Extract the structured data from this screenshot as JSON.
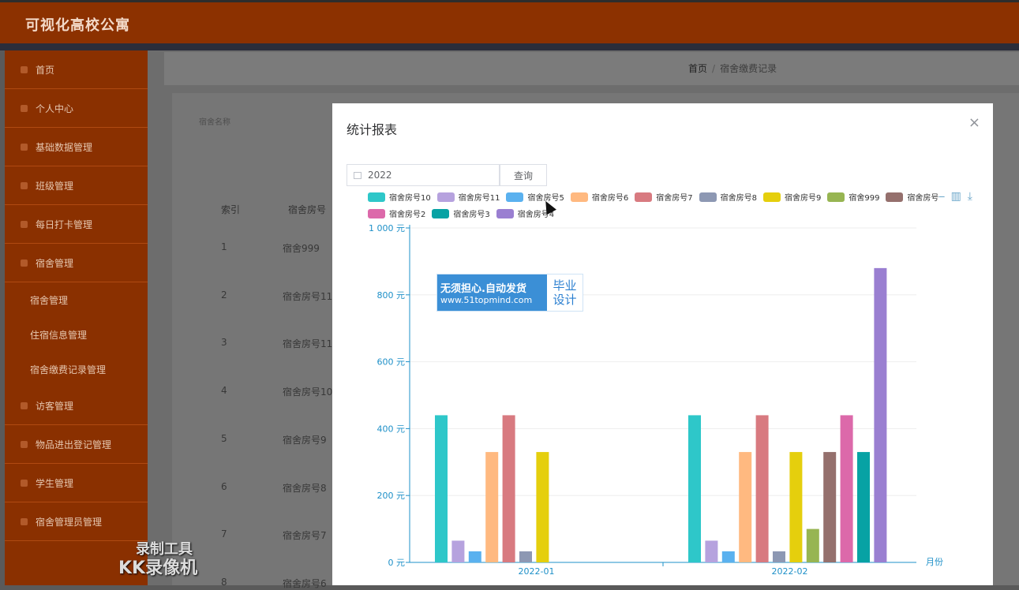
{
  "app": {
    "title": "可视化高校公寓"
  },
  "sidebar": {
    "items": [
      {
        "label": "首页",
        "type": "item"
      },
      {
        "label": "个人中心",
        "type": "item"
      },
      {
        "label": "基础数据管理",
        "type": "item"
      },
      {
        "label": "班级管理",
        "type": "item"
      },
      {
        "label": "每日打卡管理",
        "type": "item"
      },
      {
        "label": "宿舍管理",
        "type": "item"
      },
      {
        "label": "宿舍管理",
        "type": "sub"
      },
      {
        "label": "住宿信息管理",
        "type": "sub"
      },
      {
        "label": "宿舍缴费记录管理",
        "type": "sub"
      },
      {
        "label": "访客管理",
        "type": "item"
      },
      {
        "label": "物品进出登记管理",
        "type": "item"
      },
      {
        "label": "学生管理",
        "type": "item"
      },
      {
        "label": "宿舍管理员管理",
        "type": "item"
      }
    ]
  },
  "breadcrumb": {
    "home": "首页",
    "sep": "/",
    "current": "宿舍缴费记录"
  },
  "search": {
    "label": "宿舍名称"
  },
  "table": {
    "headers": [
      "索引",
      "宿舍房号"
    ],
    "rows": [
      {
        "index": "1",
        "room": "宿舍999"
      },
      {
        "index": "2",
        "room": "宿舍房号11"
      },
      {
        "index": "3",
        "room": "宿舍房号11"
      },
      {
        "index": "4",
        "room": "宿舍房号10"
      },
      {
        "index": "5",
        "room": "宿舍房号9"
      },
      {
        "index": "6",
        "room": "宿舍房号8"
      },
      {
        "index": "7",
        "room": "宿舍房号7"
      },
      {
        "index": "8",
        "room": "宿舍房号6"
      }
    ]
  },
  "modal": {
    "title": "统计报表",
    "close": "×",
    "year_value": "2022",
    "query_label": "查询"
  },
  "promo": {
    "line1": "无须担心.自动发货",
    "line2": "www.51topmind.com",
    "badge1": "毕业",
    "badge2": "设计"
  },
  "watermark": {
    "line1": "录制工具",
    "line2": "KK录像机"
  },
  "colors": {
    "topbar": "#8c3100",
    "sidebar": "#8a3000",
    "axis": "#1e90c8"
  },
  "chart_data": {
    "type": "bar",
    "categories": [
      "2022-01",
      "2022-02"
    ],
    "xlabel": "月份",
    "ylabel": "",
    "ylim": [
      0,
      1000
    ],
    "yticks": [
      0,
      200,
      400,
      600,
      800,
      1000
    ],
    "ytick_labels": [
      "0 元",
      "200 元",
      "400 元",
      "600 元",
      "800 元",
      "1 000 元"
    ],
    "series": [
      {
        "name": "宿舍房号10",
        "color": "#2ec7c9",
        "values": [
          440,
          440
        ]
      },
      {
        "name": "宿舍房号11",
        "color": "#b6a2de",
        "values": [
          65,
          65
        ]
      },
      {
        "name": "宿舍房号5",
        "color": "#5ab1ef",
        "values": [
          33,
          33
        ]
      },
      {
        "name": "宿舍房号6",
        "color": "#ffb980",
        "values": [
          330,
          330
        ]
      },
      {
        "name": "宿舍房号7",
        "color": "#d87a80",
        "values": [
          440,
          440
        ]
      },
      {
        "name": "宿舍房号8",
        "color": "#8d98b3",
        "values": [
          33,
          33
        ]
      },
      {
        "name": "宿舍房号9",
        "color": "#e5cf0d",
        "values": [
          330,
          330
        ]
      },
      {
        "name": "宿舍999",
        "color": "#97b552",
        "values": [
          0,
          100
        ]
      },
      {
        "name": "宿舍房号",
        "color": "#95706d",
        "values": [
          0,
          330
        ]
      },
      {
        "name": "宿舍房号2",
        "color": "#dc69aa",
        "values": [
          0,
          440
        ]
      },
      {
        "name": "宿舍房号3",
        "color": "#07a2a4",
        "values": [
          0,
          330
        ]
      },
      {
        "name": "宿舍房号4",
        "color": "#9a7fd1",
        "values": [
          0,
          880
        ]
      }
    ]
  }
}
